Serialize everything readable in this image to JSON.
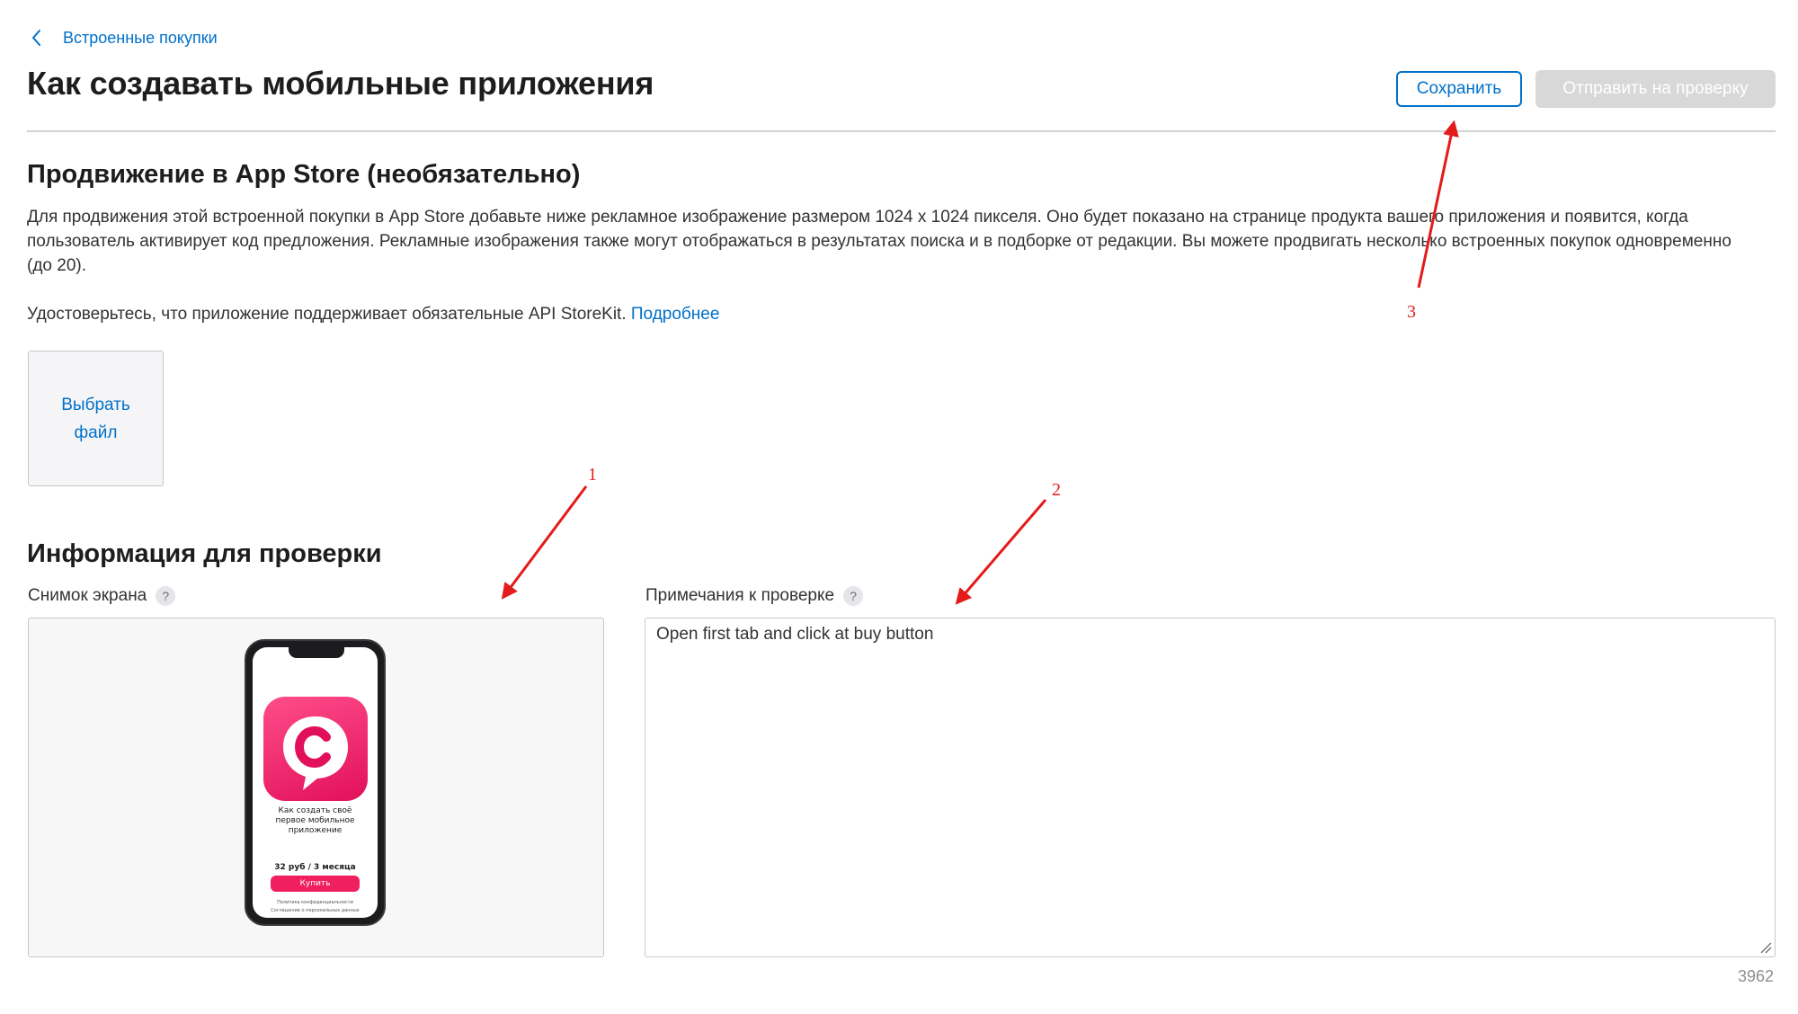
{
  "breadcrumb": {
    "label": "Встроенные покупки"
  },
  "header": {
    "title": "Как создавать мобильные приложения",
    "save_label": "Сохранить",
    "submit_label": "Отправить на проверку"
  },
  "promo": {
    "title": "Продвижение в App Store (необязательно)",
    "description": "Для продвижения этой встроенной покупки в App Store добавьте ниже рекламное изображение размером 1024 x 1024 пикселя. Оно будет показано на странице продукта вашего приложения и появится, когда пользователь активирует код предложения. Рекламные изображения также могут отображаться в результатах поиска и в подборке от редакции. Вы можете продвигать несколько встроенных покупок одновременно (до 20).",
    "storekit_note": "Удостоверьтесь, что приложение поддерживает обязательные API StoreKit.",
    "more_link": "Подробнее",
    "choose_file_line1": "Выбрать",
    "choose_file_line2": "файл"
  },
  "review": {
    "title": "Информация для проверки",
    "screenshot_label": "Снимок экрана",
    "notes_label": "Примечания к проверке",
    "help_glyph": "?",
    "notes_value": "Open first tab and click at buy button",
    "char_count": "3962"
  },
  "phone_preview": {
    "title": "Как создать своё первое мобильное приложение",
    "price": "32 руб / 3 месяца",
    "buy_label": "Купить",
    "legal_1": "Политика конфиденциальности",
    "legal_2": "Соглашение о персональных данных"
  },
  "annotations": [
    {
      "number": "1",
      "color": "#e31b1b"
    },
    {
      "number": "2",
      "color": "#e31b1b"
    },
    {
      "number": "3",
      "color": "#e31b1b"
    }
  ],
  "colors": {
    "accent": "#0070c9",
    "disabled_button": "#d8d8d8",
    "annotation": "#e31b1b",
    "app_icon": "#e2105a"
  }
}
